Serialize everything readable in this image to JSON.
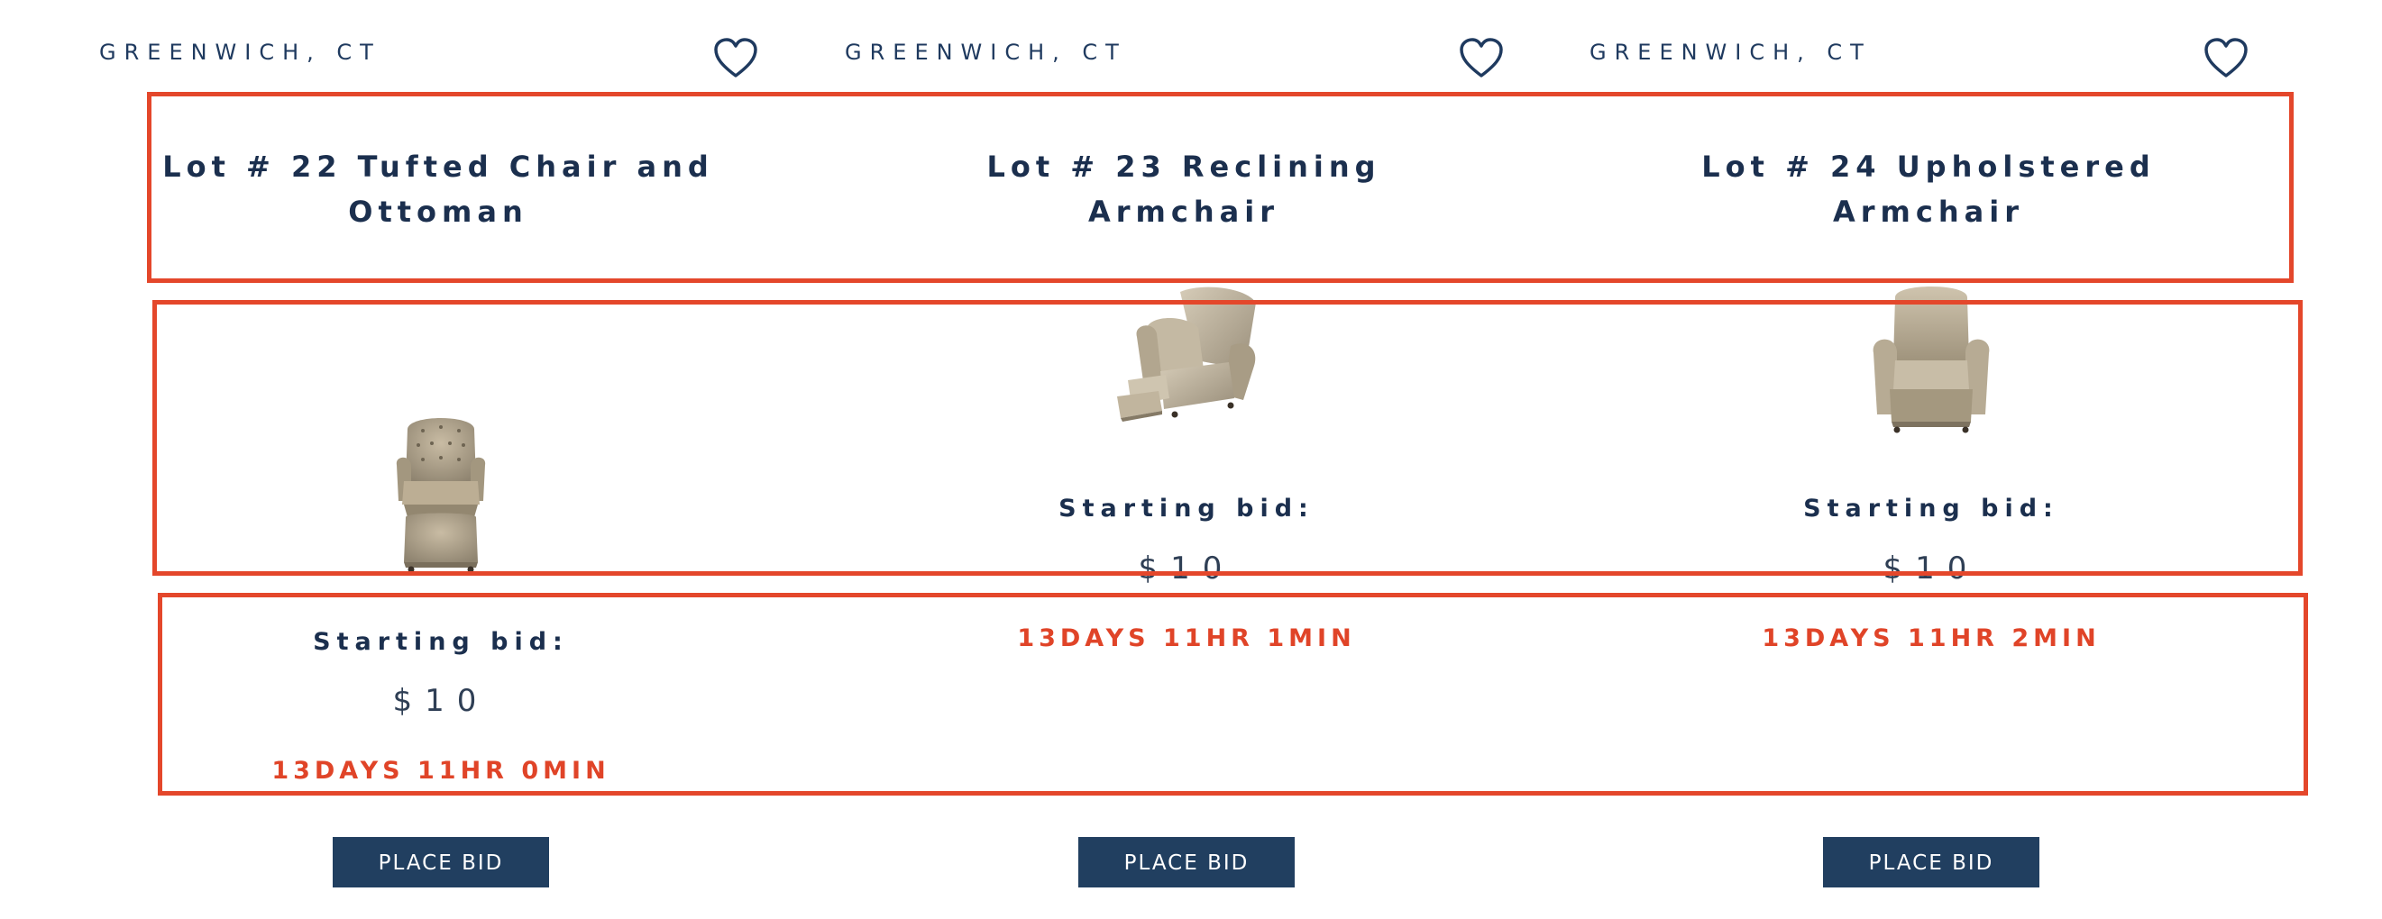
{
  "lots": [
    {
      "location": "GREENWICH, CT",
      "title": "Lot # 22 Tufted Chair and Ottoman",
      "image": "tufted-chair-and-ottoman",
      "bid_label": "Starting bid:",
      "bid_amount": "$10",
      "timer": "13DAYS 11HR 0MIN",
      "button_label": "PLACE BID"
    },
    {
      "location": "GREENWICH, CT",
      "title": "Lot # 23 Reclining Armchair",
      "image": "reclining-armchair",
      "bid_label": "Starting bid:",
      "bid_amount": "$10",
      "timer": "13DAYS 11HR 1MIN",
      "button_label": "PLACE BID"
    },
    {
      "location": "GREENWICH, CT",
      "title": "Lot # 24 Upholstered Armchair",
      "image": "upholstered-armchair",
      "bid_label": "Starting bid:",
      "bid_amount": "$10",
      "timer": "13DAYS 11HR 2MIN",
      "button_label": "PLACE BID"
    }
  ],
  "icons": {
    "favorite": "heart-outline-icon"
  },
  "colors": {
    "navy_text": "#1b2f4e",
    "button_bg": "#213f60",
    "timer_red": "#e04428",
    "highlight_red": "#e4472b"
  }
}
